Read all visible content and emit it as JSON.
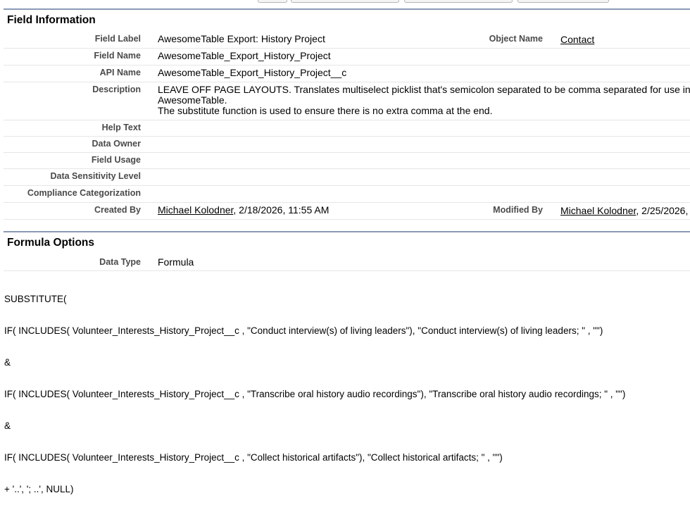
{
  "field_info": {
    "title": "Field Information",
    "field_label": {
      "label": "Field Label",
      "value": "AwesomeTable Export: History Project"
    },
    "object_name": {
      "label": "Object Name",
      "value": "Contact"
    },
    "field_name": {
      "label": "Field Name",
      "value": "AwesomeTable_Export_History_Project"
    },
    "api_name": {
      "label": "API Name",
      "value": "AwesomeTable_Export_History_Project__c"
    },
    "description": {
      "label": "Description",
      "line1": "LEAVE OFF PAGE LAYOUTS. Translates multiselect picklist that's semicolon separated to be comma separated for use in",
      "line2": "AwesomeTable.",
      "line3": "The substitute function is used to ensure there is no extra comma at the end."
    },
    "help_text": {
      "label": "Help Text",
      "value": ""
    },
    "data_owner": {
      "label": "Data Owner",
      "value": ""
    },
    "field_usage": {
      "label": "Field Usage",
      "value": ""
    },
    "data_sensitivity": {
      "label": "Data Sensitivity Level",
      "value": ""
    },
    "compliance": {
      "label": "Compliance Categorization",
      "value": ""
    },
    "created_by": {
      "label": "Created By",
      "user": "Michael Kolodner",
      "date": ", 2/18/2026, 11:55 AM"
    },
    "modified_by": {
      "label": "Modified By",
      "user": "Michael Kolodner",
      "date": ", 2/25/2026,"
    }
  },
  "formula_options": {
    "title": "Formula Options",
    "data_type": {
      "label": "Data Type",
      "value": "Formula"
    },
    "formula_lines": [
      "SUBSTITUTE(",
      "IF( INCLUDES( Volunteer_Interests_History_Project__c , \"Conduct interview(s) of living leaders\"), \"Conduct interview(s) of living leaders; \" , \"\")",
      "&",
      "IF( INCLUDES( Volunteer_Interests_History_Project__c , \"Transcribe oral history audio recordings\"), \"Transcribe oral history audio recordings; \" , \"\")",
      "&",
      "IF( INCLUDES( Volunteer_Interests_History_Project__c , \"Collect historical artifacts\"), \"Collect historical artifacts; \" , \"\")",
      "+ '..', '; ..', NULL)"
    ]
  }
}
